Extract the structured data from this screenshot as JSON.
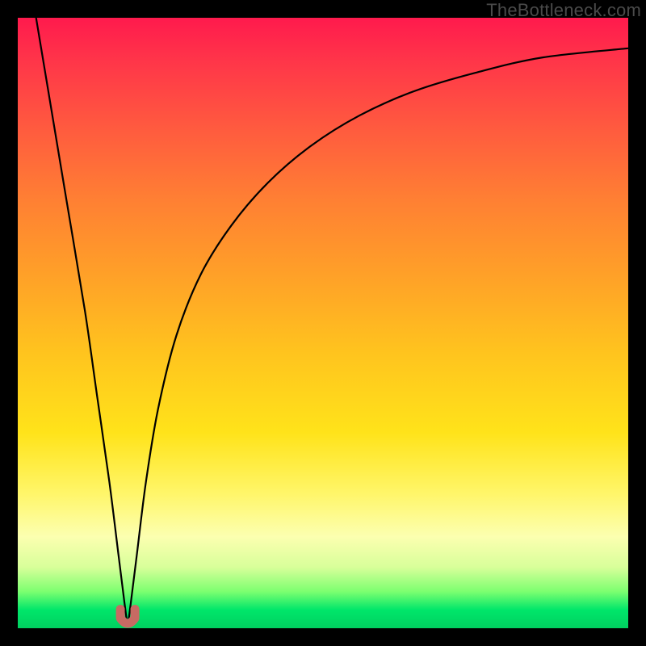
{
  "watermark": "TheBottleneck.com",
  "colors": {
    "frame": "#000000",
    "curve": "#000000",
    "marker": "#c76a63",
    "gradient_top": "#ff1a4d",
    "gradient_mid": "#ffe31a",
    "gradient_bottom": "#00d060"
  },
  "chart_data": {
    "type": "line",
    "title": "",
    "xlabel": "",
    "ylabel": "",
    "xlim": [
      0,
      100
    ],
    "ylim": [
      0,
      100
    ],
    "series": [
      {
        "name": "bottleneck-curve",
        "x": [
          3,
          5,
          8,
          11,
          13,
          15,
          16.5,
          17.5,
          18,
          18.5,
          19.5,
          21,
          23,
          26,
          30,
          35,
          41,
          48,
          56,
          65,
          75,
          86,
          100
        ],
        "y": [
          100,
          88,
          70,
          52,
          38,
          24,
          12,
          4,
          1,
          4,
          12,
          24,
          36,
          48,
          58,
          66,
          73,
          79,
          84,
          88,
          91,
          93.5,
          95
        ]
      }
    ],
    "annotations": [
      {
        "name": "minimum-marker",
        "x": 18,
        "y": 1
      }
    ]
  }
}
